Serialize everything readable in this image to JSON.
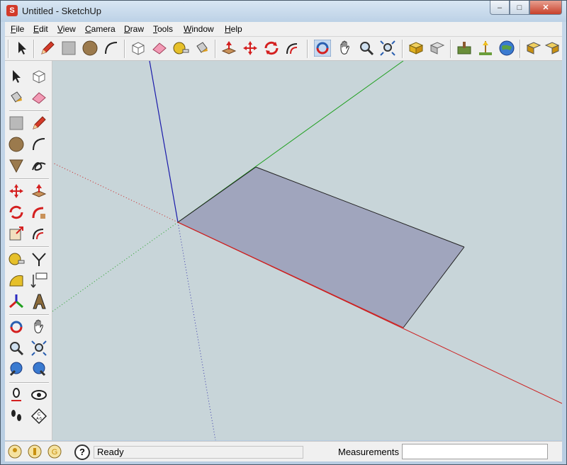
{
  "window": {
    "title": "Untitled - SketchUp",
    "app_icon": "sketchup-icon"
  },
  "menu": [
    {
      "label": "File",
      "key": "F"
    },
    {
      "label": "Edit",
      "key": "E"
    },
    {
      "label": "View",
      "key": "V"
    },
    {
      "label": "Camera",
      "key": "C"
    },
    {
      "label": "Draw",
      "key": "D"
    },
    {
      "label": "Tools",
      "key": "T"
    },
    {
      "label": "Window",
      "key": "W"
    },
    {
      "label": "Help",
      "key": "H"
    }
  ],
  "status": {
    "text": "Ready",
    "measurements_label": "Measurements",
    "measurements_value": ""
  },
  "colors": {
    "viewport_bg": "#c8d5d9",
    "face_fill": "#a0a5bd",
    "red_axis": "#cc2020",
    "green_axis": "#20a020",
    "blue_axis": "#1a1aaa"
  }
}
